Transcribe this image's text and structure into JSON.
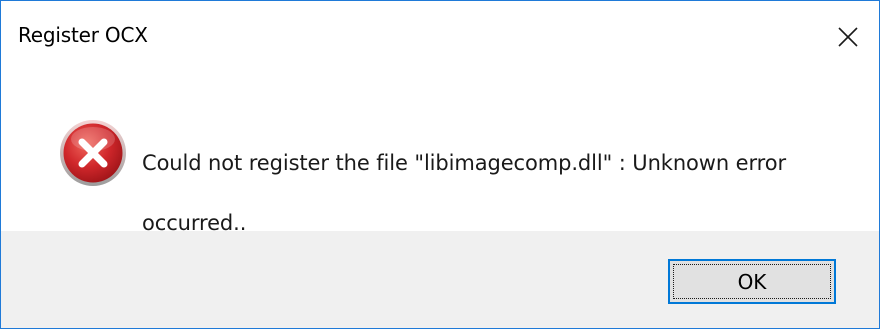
{
  "window": {
    "title": "Register OCX"
  },
  "titlebar": {
    "close_icon": "close-icon"
  },
  "message": {
    "icon": "error-icon",
    "line1": "Could not register the file \"libimagecomp.dll\" : Unknown error",
    "line2": "occurred.."
  },
  "buttons": {
    "ok_label": "OK"
  },
  "colors": {
    "window_border": "#1f7ad8",
    "footer_background": "#f0f0f0",
    "button_background": "#e1e1e1",
    "button_focus_border": "#0078d7",
    "error_icon_red": "#d0272b"
  }
}
